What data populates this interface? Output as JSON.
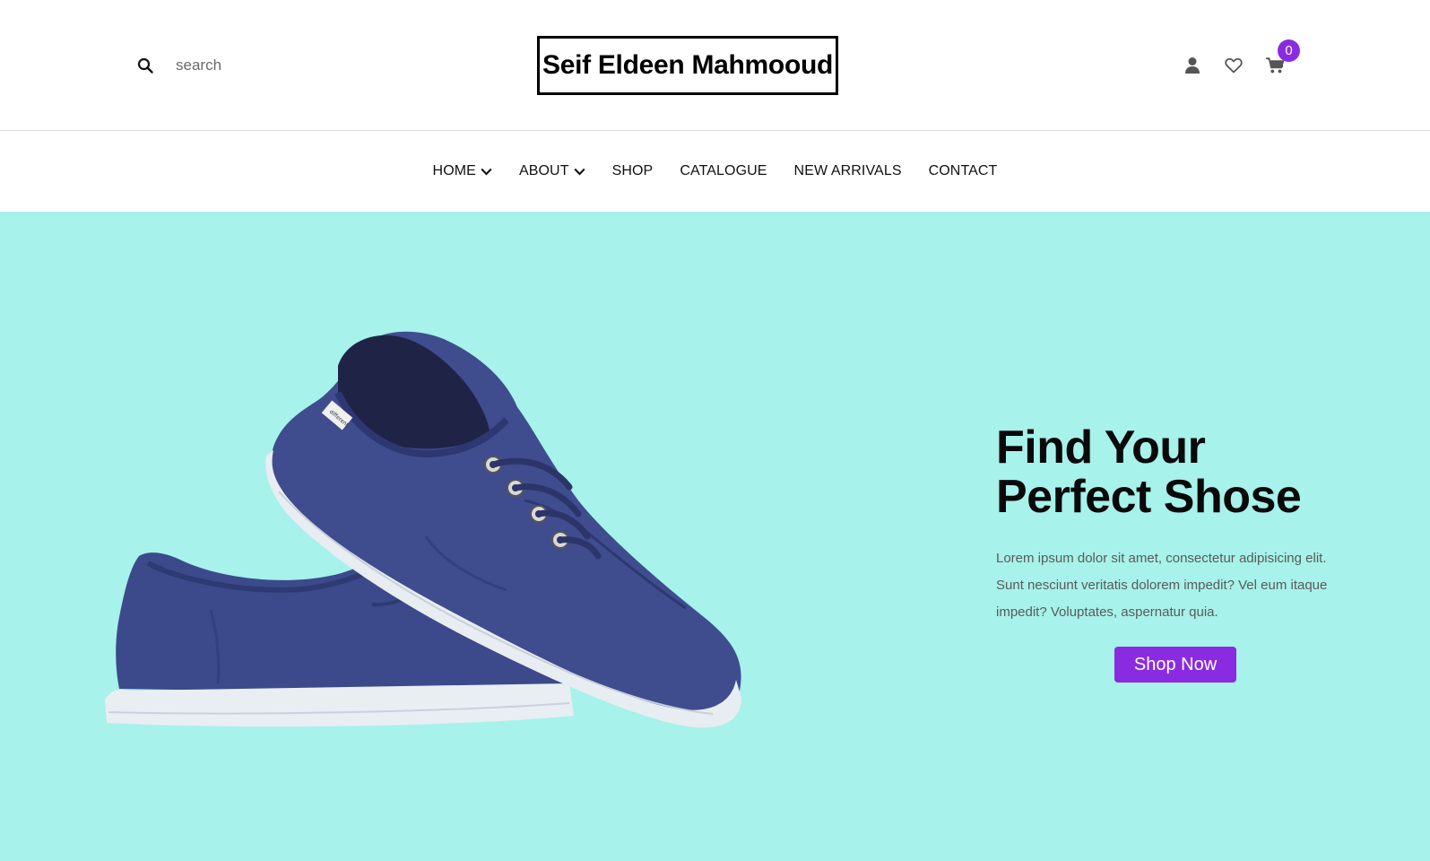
{
  "header": {
    "search": {
      "placeholder": "search",
      "icon": "search-icon"
    },
    "logo_text": "Seif Eldeen Mahmooud",
    "icons": [
      "user-icon",
      "heart-icon",
      "cart-icon"
    ],
    "cart_count": "0"
  },
  "nav": {
    "items": [
      {
        "label": "HOME",
        "has_dropdown": true
      },
      {
        "label": "ABOUT",
        "has_dropdown": true
      },
      {
        "label": "SHOP",
        "has_dropdown": false
      },
      {
        "label": "CATALOGUE",
        "has_dropdown": false
      },
      {
        "label": "NEW ARRIVALS",
        "has_dropdown": false
      },
      {
        "label": "CONTACT",
        "has_dropdown": false
      }
    ]
  },
  "hero": {
    "title_line1": "Find Your",
    "title_line2": "Perfect Shose",
    "description": "Lorem ipsum dolor sit amet, consectetur adipisicing elit. Sunt nesciunt veritatis dolorem impedit? Vel eum itaque impedit? Voluptates, aspernatur quia.",
    "button_label": "Shop Now",
    "shoe_tag": "different"
  },
  "colors": {
    "accent": "#8a2be2",
    "hero_background": "#a7f2eb",
    "shoe_canvas": "#3f4d8f",
    "sole": "#e9eef3"
  }
}
